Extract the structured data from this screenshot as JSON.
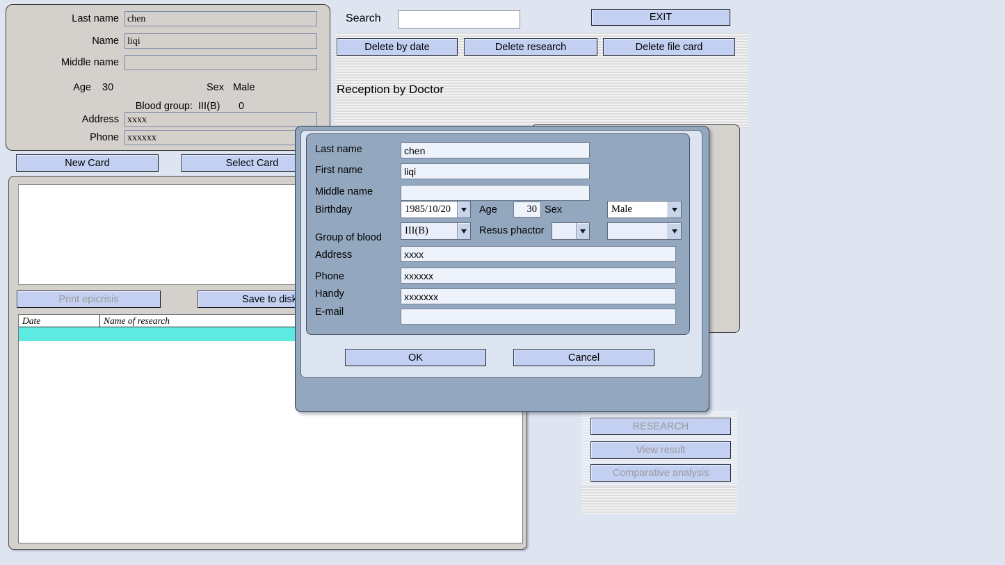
{
  "app": {
    "background_color": "#dee5f1",
    "accent_button_color": "#c3d0f2",
    "selection_color": "#5ceae1"
  },
  "patient_card": {
    "fields": [
      {
        "label": "Last name",
        "value": "chen"
      },
      {
        "label": "Name",
        "value": "liqi"
      },
      {
        "label": "Middle name",
        "value": ""
      }
    ],
    "age_label": "Age",
    "age_value": "30",
    "sex_label": "Sex",
    "sex_value": "Male",
    "blood_group_label": "Blood group:",
    "blood_group_value": "III(B)",
    "resus_value": "0",
    "address_label": "Address",
    "address_value": "xxxx",
    "phone_label": "Phone",
    "phone_value": "xxxxxx",
    "buttons": {
      "new_card": "New Card",
      "select_card": "Select Card"
    }
  },
  "bottom_panel": {
    "epicrisis_text": "",
    "buttons": {
      "print_epicrisis": "Print epicrisis",
      "print_epicrisis_enabled": false,
      "save_to_disk": "Save to disk",
      "save_to_disk_enabled": true
    },
    "table": {
      "columns": [
        "Date",
        "Name of research"
      ],
      "rows": [
        {
          "date": "",
          "name": "",
          "selected": true
        }
      ]
    }
  },
  "toolbar": {
    "search_label": "Search",
    "search_value": "",
    "search_placeholder": "",
    "exit_label": "EXIT",
    "delete_by_date": "Delete by date",
    "delete_research": "Delete research",
    "delete_file_card": "Delete file card",
    "reception_title": "Reception by Doctor"
  },
  "right_actions": {
    "research": "RESEARCH",
    "research_enabled": false,
    "view_result": "View result",
    "view_result_enabled": false,
    "comparative_analysis": "Comparative analysis",
    "comparative_analysis_enabled": false
  },
  "dialog": {
    "labels": {
      "last_name": "Last name",
      "first_name": "First name",
      "middle_name": "Middle name",
      "birthday": "Birthday",
      "age": "Age",
      "sex": "Sex",
      "group_of_blood": "Group of blood",
      "resus_phactor": "Resus phactor",
      "address": "Address",
      "phone": "Phone",
      "handy": "Handy",
      "email": "E-mail"
    },
    "values": {
      "last_name": "chen",
      "first_name": "liqi",
      "middle_name": "",
      "birthday": "1985/10/20",
      "age": "30",
      "sex": "Male",
      "group_of_blood": "III(B)",
      "resus_phactor": "",
      "resus_phactor_extra": "",
      "address": "xxxx",
      "phone": "xxxxxx",
      "handy": "xxxxxxx",
      "email": ""
    },
    "buttons": {
      "ok": "OK",
      "cancel": "Cancel"
    }
  }
}
